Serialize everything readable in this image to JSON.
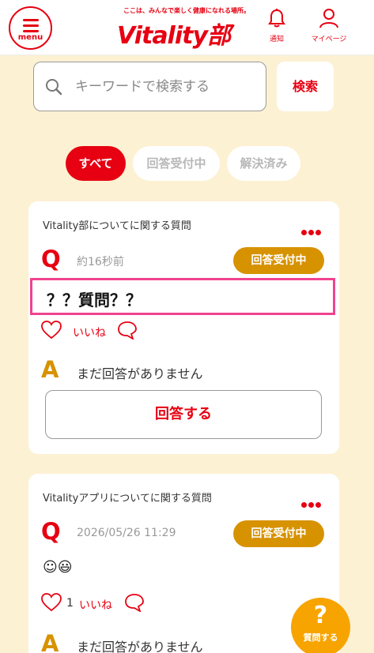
{
  "header": {
    "menu_label": "menu",
    "tagline": "ここは、みんなで楽しく健康になれる場所。",
    "logo_text": "Vitality部",
    "notify_label": "通知",
    "mypage_label": "マイページ"
  },
  "search": {
    "placeholder": "キーワードで検索する",
    "button_label": "検索"
  },
  "tabs": [
    {
      "label": "すべて",
      "active": true
    },
    {
      "label": "回答受付中",
      "active": false
    },
    {
      "label": "解決済み",
      "active": false
    }
  ],
  "questions": [
    {
      "category": "Vitality部についてに関する質問",
      "q_mark": "Q",
      "time": "約16秒前",
      "status": "回答受付中",
      "title": "？？質問？？",
      "like_count": "",
      "like_label": "いいね",
      "a_mark": "A",
      "answer_text": "まだ回答がありません",
      "answer_button": "回答する"
    },
    {
      "category": "Vitalityアプリについてに関する質問",
      "q_mark": "Q",
      "time": "2026/05/26 11:29",
      "status": "回答受付中",
      "title": "☺😃",
      "like_count": "1",
      "like_label": "いいね",
      "a_mark": "A",
      "answer_text": "まだ回答がありません"
    }
  ],
  "fab": {
    "mark": "?",
    "label": "質問する"
  },
  "colors": {
    "brand_red": "#e60012",
    "status_gold": "#d79200",
    "fab_orange": "#f7a400",
    "background": "#fdf1d3",
    "highlight": "#f0438f"
  }
}
